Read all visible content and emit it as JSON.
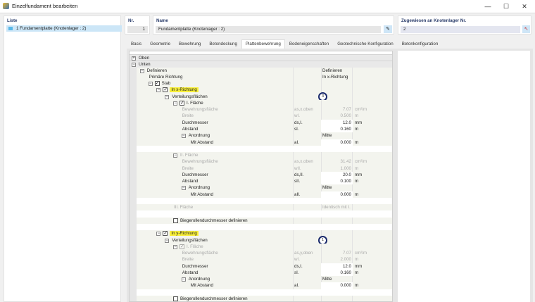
{
  "window": {
    "title": "Einzelfundament bearbeiten",
    "minimize": "—",
    "maximize": "☐",
    "close": "✕",
    "icon": "foundation-app-icon"
  },
  "liste": {
    "header": "Liste",
    "items": [
      {
        "label": "1  Fundamentplatte (Knotenlager : 2)",
        "color": "#5ab8e8"
      }
    ]
  },
  "nr": {
    "label": "Nr.",
    "value": "1"
  },
  "name": {
    "label": "Name",
    "value": "Fundamentplatte (Knotenlager : 2)",
    "edit_icon": "edit-icon"
  },
  "assigned": {
    "label": "Zugewiesen an Knotenlager Nr.",
    "value": "2",
    "pick_icon": "pick-node-icon"
  },
  "tabs": [
    "Basis",
    "Geometrie",
    "Bewehrung",
    "Betondeckung",
    "Plattenbewehrung",
    "Bodeneigenschaften",
    "Geotechnische Konfiguration",
    "Betonkonfiguration"
  ],
  "active_tab": "Plattenbewehrung",
  "tree": [
    {
      "t": "group",
      "lvl": 0,
      "exp": "+",
      "text": "Oben"
    },
    {
      "t": "group",
      "lvl": 0,
      "exp": "−",
      "text": "Unten"
    },
    {
      "lvl": 1,
      "exp": "−",
      "text": "Definieren",
      "vtext": "Definieren"
    },
    {
      "lvl": 2,
      "text": "Primäre Richtung",
      "vtext": "In x-Richtung"
    },
    {
      "lvl": 2,
      "exp": "−",
      "cb": true,
      "text": "Stab"
    },
    {
      "lvl": 3,
      "exp": "−",
      "cb": true,
      "hl": true,
      "text": "In x-Richtung"
    },
    {
      "lvl": 4,
      "exp": "−",
      "text": "Verteilungsflächen",
      "circle": "3"
    },
    {
      "lvl": 5,
      "exp": "−",
      "cb": true,
      "text": "I. Fläche"
    },
    {
      "lvl": 6,
      "dis": true,
      "text": "Bewehrungsfläche",
      "sym": "as,x,oben",
      "val": "7.07",
      "unit": "cm²/m"
    },
    {
      "lvl": 6,
      "dis": true,
      "text": "Breite",
      "sym": "wI.",
      "val": "0.500",
      "unit": "m"
    },
    {
      "lvl": 6,
      "text": "Durchmesser",
      "sym": "ds,I.",
      "val": "12.0",
      "unit": "mm",
      "ed": true
    },
    {
      "lvl": 6,
      "text": "Abstand",
      "sym": "sI.",
      "val": "0.160",
      "unit": "m",
      "ed": true
    },
    {
      "lvl": 6,
      "exp": "−",
      "text": "Anordnung",
      "vtext": "Mitte"
    },
    {
      "lvl": 7,
      "text": "Mit Abstand",
      "sym": "aI.",
      "val": "0.000",
      "unit": "m",
      "ed": true
    },
    {
      "t": "blank"
    },
    {
      "lvl": 5,
      "exp": "−",
      "dis": true,
      "text": "II. Fläche"
    },
    {
      "lvl": 6,
      "dis": true,
      "text": "Bewehrungsfläche",
      "sym": "as,x,oben",
      "val": "31.42",
      "unit": "cm²/m"
    },
    {
      "lvl": 6,
      "dis": true,
      "text": "Breite",
      "sym": "wII.",
      "val": "1.000",
      "unit": "m"
    },
    {
      "lvl": 6,
      "text": "Durchmesser",
      "sym": "ds,II.",
      "val": "20.0",
      "unit": "mm",
      "ed": true
    },
    {
      "lvl": 6,
      "text": "Abstand",
      "sym": "sII.",
      "val": "0.100",
      "unit": "m",
      "ed": true
    },
    {
      "lvl": 6,
      "exp": "−",
      "text": "Anordnung",
      "vtext": "Mitte"
    },
    {
      "lvl": 7,
      "text": "Mit Abstand",
      "sym": "aII.",
      "val": "0.000",
      "unit": "m",
      "ed": true
    },
    {
      "t": "blank"
    },
    {
      "lvl": 5,
      "dis": true,
      "text": "III. Fläche",
      "vtext": "Identisch mit I.",
      "vdis": true
    },
    {
      "t": "blank"
    },
    {
      "lvl": 5,
      "cb": false,
      "text": "Biegerollendurchmesser definieren"
    },
    {
      "t": "blank"
    },
    {
      "lvl": 3,
      "exp": "−",
      "cb": true,
      "hl": true,
      "text": "In y-Richtung"
    },
    {
      "lvl": 4,
      "exp": "−",
      "text": "Verteilungsflächen",
      "circle": "1"
    },
    {
      "lvl": 5,
      "exp": "−",
      "cb": true,
      "dis": true,
      "text": "I. Fläche"
    },
    {
      "lvl": 6,
      "dis": true,
      "text": "Bewehrungsfläche",
      "sym": "as,y,oben",
      "val": "7.07",
      "unit": "cm²/m"
    },
    {
      "lvl": 6,
      "dis": true,
      "text": "Breite",
      "sym": "wI.",
      "val": "2.000",
      "unit": "m"
    },
    {
      "lvl": 6,
      "text": "Durchmesser",
      "sym": "ds,I.",
      "val": "12.0",
      "unit": "mm",
      "ed": true
    },
    {
      "lvl": 6,
      "text": "Abstand",
      "sym": "sI.",
      "val": "0.160",
      "unit": "m",
      "ed": true
    },
    {
      "lvl": 6,
      "exp": "−",
      "text": "Anordnung",
      "vtext": "Mitte"
    },
    {
      "lvl": 7,
      "text": "Mit Abstand",
      "sym": "aI.",
      "val": "0.000",
      "unit": "m",
      "ed": true
    },
    {
      "t": "blank"
    },
    {
      "lvl": 5,
      "cb": false,
      "text": "Biegerollendurchmesser definieren"
    }
  ]
}
